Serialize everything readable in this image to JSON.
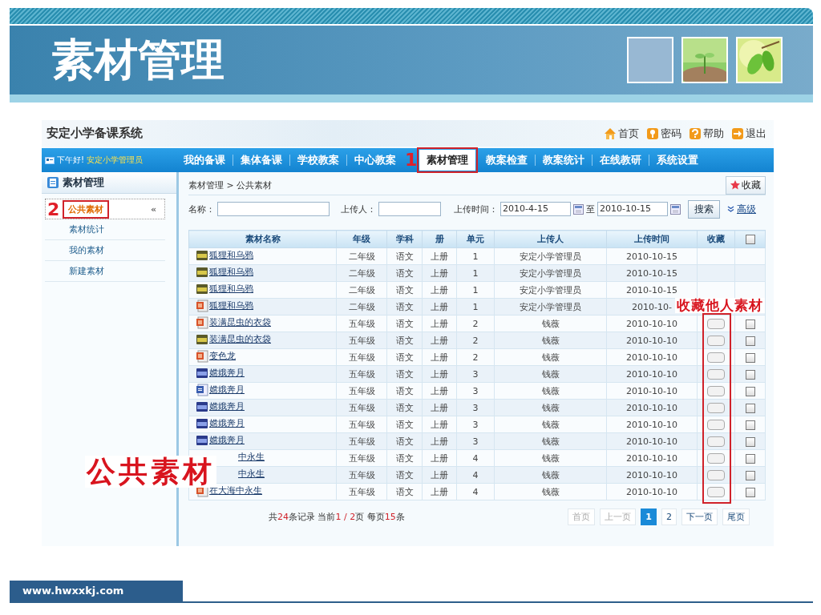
{
  "slide": {
    "title": "素材管理",
    "footer": "www.hwxxkj.com"
  },
  "app": {
    "logo": "安定小学备课系统",
    "top_links": [
      {
        "label": "首页",
        "kind": "home"
      },
      {
        "label": "密码",
        "kind": "key"
      },
      {
        "label": "帮助",
        "kind": "help"
      },
      {
        "label": "退出",
        "kind": "exit"
      }
    ],
    "greeting": "下午好!",
    "user": "安定小学管理员",
    "nav": [
      {
        "label": "我的备课",
        "selected": false
      },
      {
        "label": "集体备课",
        "selected": false
      },
      {
        "label": "学校教案",
        "selected": false
      },
      {
        "label": "中心教案",
        "selected": false
      },
      {
        "label": "素材管理",
        "selected": true,
        "marker": "1"
      },
      {
        "label": "教案检查",
        "selected": false
      },
      {
        "label": "教案统计",
        "selected": false
      },
      {
        "label": "在线教研",
        "selected": false
      },
      {
        "label": "系统设置",
        "selected": false
      }
    ],
    "sidebar": {
      "title": "素材管理",
      "collapse": "«",
      "items": [
        {
          "label": "公共素材",
          "selected": true,
          "marker": "2"
        },
        {
          "label": "素材统计",
          "selected": false
        },
        {
          "label": "我的素材",
          "selected": false
        },
        {
          "label": "新建素材",
          "selected": false
        }
      ]
    },
    "breadcrumb": "素材管理 > 公共素材",
    "favorite_button": "收藏",
    "search": {
      "name_label": "名称：",
      "uploader_label": "上传人：",
      "time_label": "上传时间：",
      "date_from": "2010-4-15",
      "to_label": "至",
      "date_to": "2010-10-15",
      "search_button": "搜索",
      "advanced_link": "高级"
    },
    "table": {
      "columns": [
        "素材名称",
        "年级",
        "学科",
        "册",
        "单元",
        "上传人",
        "上传时间",
        "收藏"
      ],
      "select_all": {
        "checked": false
      },
      "rows": [
        {
          "name": "狐狸和乌鸦",
          "file": {
            "kind": "jpg"
          },
          "grade": "二年级",
          "subject": "语文",
          "volume": "上册",
          "unit": "1",
          "uploader": "安定小学管理员",
          "time": "2010-10-15",
          "kind": "own"
        },
        {
          "name": "狐狸和乌鸦",
          "file": {
            "kind": "jpg"
          },
          "grade": "二年级",
          "subject": "语文",
          "volume": "上册",
          "unit": "1",
          "uploader": "安定小学管理员",
          "time": "2010-10-15",
          "kind": "own"
        },
        {
          "name": "狐狸和乌鸦",
          "file": {
            "kind": "jpg"
          },
          "grade": "二年级",
          "subject": "语文",
          "volume": "上册",
          "unit": "1",
          "uploader": "安定小学管理员",
          "time": "2010-10-15",
          "kind": "own"
        },
        {
          "name": "狐狸和乌鸦",
          "file": {
            "kind": "ppt"
          },
          "grade": "二年级",
          "subject": "语文",
          "volume": "上册",
          "unit": "1",
          "uploader": "安定小学管理员",
          "time": "2010-10-",
          "kind": "own"
        },
        {
          "name": "装满昆虫的衣袋",
          "file": {
            "kind": "ppt"
          },
          "grade": "五年级",
          "subject": "语文",
          "volume": "上册",
          "unit": "2",
          "uploader": "钱薇",
          "time": "2010-10-10",
          "kind": "shared",
          "checked": false
        },
        {
          "name": "装满昆虫的衣袋",
          "file": {
            "kind": "jpg"
          },
          "grade": "五年级",
          "subject": "语文",
          "volume": "上册",
          "unit": "2",
          "uploader": "钱薇",
          "time": "2010-10-10",
          "kind": "shared",
          "checked": false
        },
        {
          "name": "变色龙",
          "file": {
            "kind": "ppt"
          },
          "grade": "五年级",
          "subject": "语文",
          "volume": "上册",
          "unit": "2",
          "uploader": "钱薇",
          "time": "2010-10-10",
          "kind": "shared",
          "checked": false
        },
        {
          "name": "嫦娥奔月",
          "file": {
            "kind": "bmp"
          },
          "grade": "五年级",
          "subject": "语文",
          "volume": "上册",
          "unit": "3",
          "uploader": "钱薇",
          "time": "2010-10-10",
          "kind": "shared",
          "checked": false
        },
        {
          "name": "嫦娥奔月",
          "file": {
            "kind": "doc"
          },
          "grade": "五年级",
          "subject": "语文",
          "volume": "上册",
          "unit": "3",
          "uploader": "钱薇",
          "time": "2010-10-10",
          "kind": "shared",
          "checked": false
        },
        {
          "name": "嫦娥奔月",
          "file": {
            "kind": "bmp"
          },
          "grade": "五年级",
          "subject": "语文",
          "volume": "上册",
          "unit": "3",
          "uploader": "钱薇",
          "time": "2010-10-10",
          "kind": "shared",
          "checked": false
        },
        {
          "name": "嫦娥奔月",
          "file": {
            "kind": "bmp"
          },
          "grade": "五年级",
          "subject": "语文",
          "volume": "上册",
          "unit": "3",
          "uploader": "钱薇",
          "time": "2010-10-10",
          "kind": "shared",
          "checked": false
        },
        {
          "name": "嫦娥奔月",
          "file": {
            "kind": "bmp"
          },
          "grade": "五年级",
          "subject": "语文",
          "volume": "上册",
          "unit": "3",
          "uploader": "钱薇",
          "time": "2010-10-10",
          "kind": "shared",
          "checked": false
        },
        {
          "name": "中永生",
          "grade": "五年级",
          "subject": "语文",
          "volume": "上册",
          "unit": "4",
          "uploader": "钱薇",
          "time": "2010-10-10",
          "kind": "shared",
          "checked": false
        },
        {
          "name": "中永生",
          "grade": "五年级",
          "subject": "语文",
          "volume": "上册",
          "unit": "4",
          "uploader": "钱薇",
          "time": "2010-10-10",
          "kind": "shared",
          "checked": false
        },
        {
          "name": "在大海中永生",
          "file": {
            "kind": "ppt"
          },
          "grade": "五年级",
          "subject": "语文",
          "volume": "上册",
          "unit": "4",
          "uploader": "钱薇",
          "time": "2010-10-10",
          "kind": "shared",
          "checked": false
        }
      ]
    },
    "pager": {
      "summary": [
        {
          "text": "共",
          "highlight": false
        },
        {
          "text": "24",
          "highlight": true
        },
        {
          "text": "条记录 当前",
          "highlight": false
        },
        {
          "text": "1 / 2",
          "highlight": true
        },
        {
          "text": "页 每页",
          "highlight": false
        },
        {
          "text": "15",
          "highlight": true
        },
        {
          "text": "条",
          "highlight": false
        }
      ],
      "buttons": [
        {
          "label": "首页",
          "selected": false,
          "disabled": true
        },
        {
          "label": "上一页",
          "selected": false,
          "disabled": true
        },
        {
          "label": "1",
          "selected": true,
          "disabled": false
        },
        {
          "label": "2",
          "selected": false,
          "disabled": false
        },
        {
          "label": "下一页",
          "selected": false,
          "disabled": false
        },
        {
          "label": "尾页",
          "selected": false,
          "disabled": false
        }
      ]
    },
    "annotations": {
      "page_label": "公共素材",
      "column_label": "收藏他人素材"
    }
  }
}
